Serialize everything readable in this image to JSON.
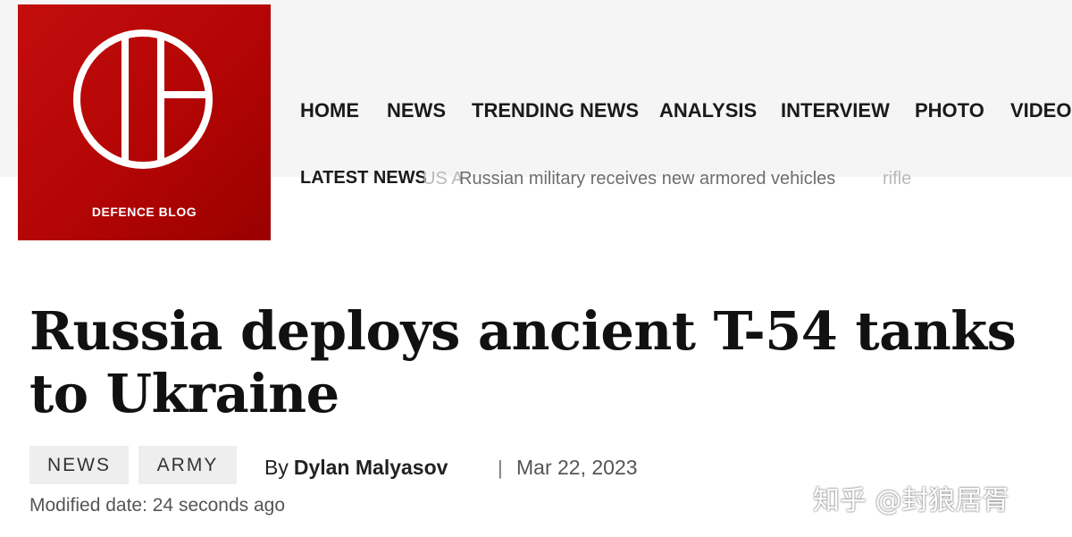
{
  "brand": {
    "name": "DEFENCE BLOG",
    "color": "#b30505"
  },
  "nav": {
    "items": [
      "HOME",
      "NEWS",
      "TRENDING NEWS",
      "ANALYSIS",
      "INTERVIEW",
      "PHOTO",
      "VIDEO"
    ]
  },
  "ticker": {
    "label": "LATEST NEWS",
    "previous_fragment": "US A",
    "current": "Russian military receives new armored vehicles",
    "trailing_fragment": "rifle"
  },
  "article": {
    "title": "Russia deploys ancient T-54 tanks to Ukraine",
    "tags": [
      "NEWS",
      "ARMY"
    ],
    "by_label": "By",
    "author": "Dylan Malyasov",
    "separator": "|",
    "date": "Mar 22, 2023",
    "modified": "Modified date: 24 seconds ago"
  },
  "watermark": "知乎 @封狼居胥"
}
